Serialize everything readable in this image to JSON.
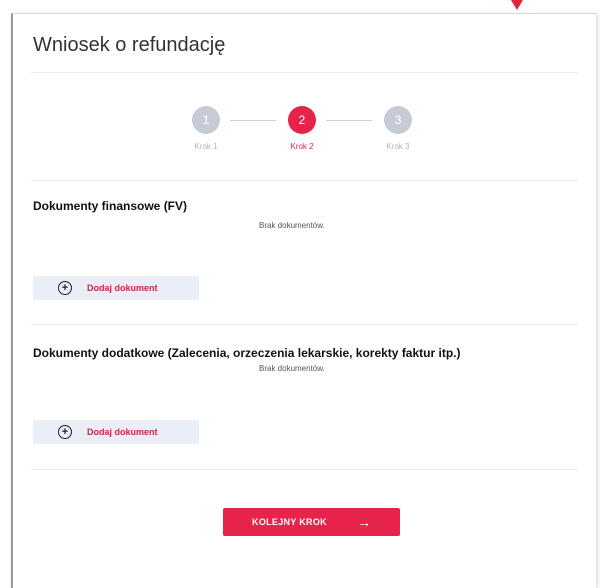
{
  "page": {
    "title": "Wniosek o refundację"
  },
  "stepper": {
    "steps": [
      {
        "number": "1",
        "label": "Krok 1"
      },
      {
        "number": "2",
        "label": "Krok 2"
      },
      {
        "number": "3",
        "label": "Krok 3"
      }
    ],
    "active_step": 2
  },
  "sections": [
    {
      "title": "Dokumenty finansowe (FV)",
      "empty_text": "Brak dokumentów.",
      "add_label": "Dodaj dokument"
    },
    {
      "title": "Dokumenty dodatkowe (Zalecenia, orzeczenia lekarskie, korekty faktur itp.)",
      "empty_text": "Brak dokumentów.",
      "add_label": "Dodaj dokument"
    }
  ],
  "footer": {
    "next_label": "KOLEJNY KROK",
    "next_arrow": "→"
  },
  "icons": {
    "add": "plus-circle-icon",
    "next": "arrow-right-icon"
  },
  "colors": {
    "accent": "#e5234b",
    "inactive_step": "#c6ccd6",
    "add_button_bg": "#e9eef7"
  }
}
